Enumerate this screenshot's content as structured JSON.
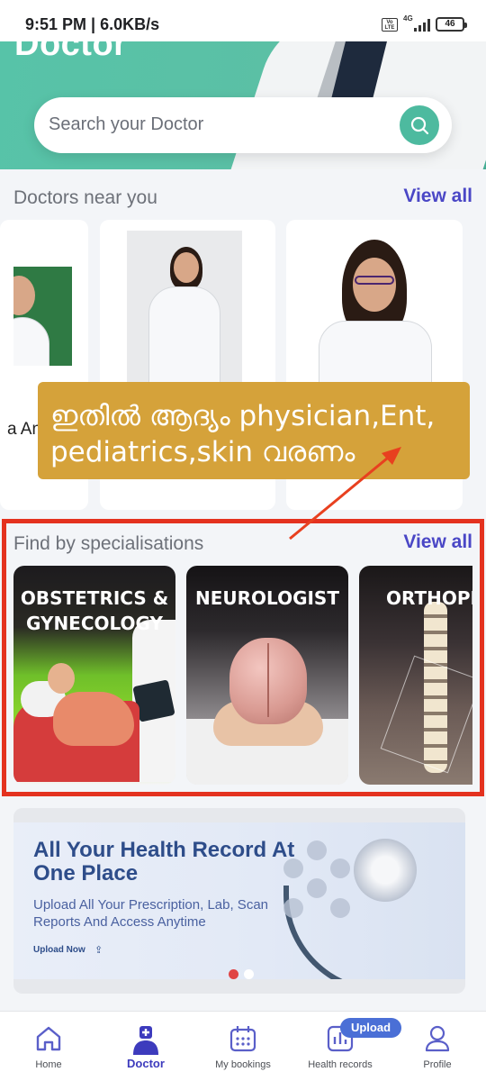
{
  "status_bar": {
    "time": "9:51 PM | 6.0KB/s",
    "volte": "Vo LTE",
    "network": "4G",
    "battery": "46"
  },
  "hero": {
    "title": "Doctor",
    "search_placeholder": "Search your Doctor"
  },
  "doctors_near_you": {
    "title": "Doctors near you",
    "view_all": "View all",
    "partial_name": "a An"
  },
  "annotation_note": {
    "text": "ഇതിൽ ആദ്യം physician,Ent, pediatrics,skin വരണം",
    "colors": {
      "note_bg": "#d5a23a",
      "frame": "#e4321f",
      "arrow": "#e8401f"
    }
  },
  "specialisations": {
    "title": "Find by specialisations",
    "view_all": "View all",
    "items": [
      {
        "label": "OBSTETRICS & GYNECOLOGY"
      },
      {
        "label": "NEUROLOGIST"
      },
      {
        "label": "ORTHOPED"
      }
    ]
  },
  "banner": {
    "title": "All Your Health Record At One Place",
    "description": "Upload All Your Prescription, Lab, Scan Reports And Access Anytime",
    "upload_now": "Upload Now",
    "slides": 2,
    "active_slide": 1
  },
  "bottom_nav": {
    "items": [
      {
        "label": "Home",
        "icon": "home-icon"
      },
      {
        "label": "Doctor",
        "icon": "doctor-icon"
      },
      {
        "label": "My bookings",
        "icon": "calendar-icon"
      },
      {
        "label": "Health records",
        "icon": "chart-icon"
      },
      {
        "label": "Profile",
        "icon": "profile-icon"
      }
    ],
    "active": "Doctor",
    "upload_badge": "Upload"
  },
  "colors": {
    "accent_green": "#4dba9f",
    "link_purple": "#4a47c6",
    "nav_active": "#3d3bbd",
    "banner_text": "#2e4d8a"
  }
}
